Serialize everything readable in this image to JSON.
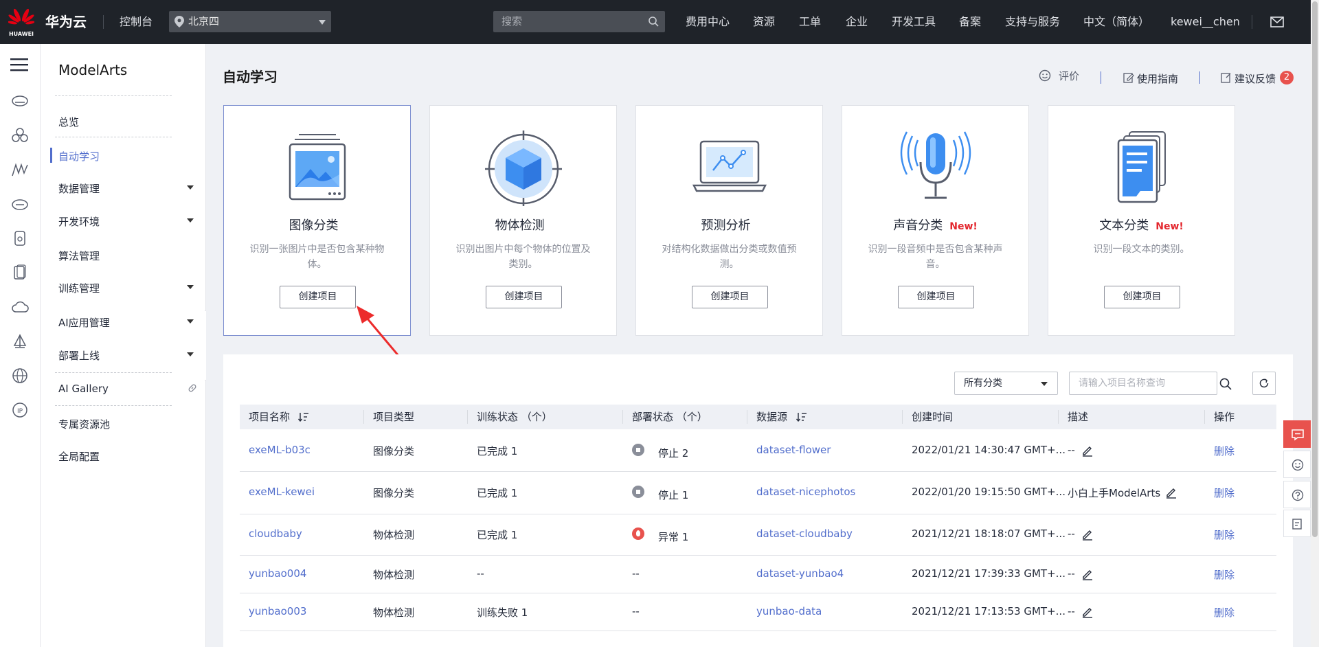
{
  "header": {
    "brand_logo_text": "HUAWEI",
    "brand_name": "华为云",
    "console_label": "控制台",
    "region": "北京四",
    "search_placeholder": "搜索",
    "menu": [
      "费用中心",
      "资源",
      "工单",
      "企业",
      "开发工具",
      "备案",
      "支持与服务",
      "中文（简体）",
      "kewei__chen"
    ]
  },
  "sidebar": {
    "title": "ModelArts",
    "items": [
      {
        "label": "总览"
      },
      {
        "label": "自动学习",
        "active": true
      },
      {
        "label": "数据管理"
      },
      {
        "label": "开发环境"
      },
      {
        "label": "算法管理"
      },
      {
        "label": "训练管理"
      },
      {
        "label": "AI应用管理"
      },
      {
        "label": "部署上线"
      },
      {
        "label": "AI Gallery"
      },
      {
        "label": "专属资源池"
      },
      {
        "label": "全局配置"
      }
    ]
  },
  "page": {
    "title": "自动学习",
    "actions": {
      "rate": "评价",
      "guide": "使用指南",
      "feedback": "建议反馈",
      "feedback_count": "2"
    }
  },
  "cards": [
    {
      "title": "图像分类",
      "new": "",
      "desc": "识别一张图片中是否包含某种物体。",
      "button": "创建项目",
      "icon": "image-classification-icon"
    },
    {
      "title": "物体检测",
      "new": "",
      "desc": "识别出图片中每个物体的位置及类别。",
      "button": "创建项目",
      "icon": "object-detection-icon"
    },
    {
      "title": "预测分析",
      "new": "",
      "desc": "对结构化数据做出分类或数值预测。",
      "button": "创建项目",
      "icon": "predictive-analysis-icon"
    },
    {
      "title": "声音分类",
      "new": "New!",
      "desc": "识别一段音频中是否包含某种声音。",
      "button": "创建项目",
      "icon": "sound-classification-icon"
    },
    {
      "title": "文本分类",
      "new": "New!",
      "desc": "识别一段文本的类别。",
      "button": "创建项目",
      "icon": "text-classification-icon"
    }
  ],
  "filters": {
    "category": "所有分类",
    "search_placeholder": "请输入项目名称查询"
  },
  "table": {
    "headers": [
      "项目名称",
      "项目类型",
      "训练状态 （个）",
      "部署状态 （个）",
      "数据源",
      "创建时间",
      "描述",
      "操作"
    ],
    "rows": [
      {
        "name": "exeML-b03c",
        "type": "图像分类",
        "train": "已完成 1",
        "deploy": "停止 2",
        "deploy_state": "stopped",
        "source": "dataset-flower",
        "time": "2022/01/21 14:30:47 GMT+...",
        "desc": "--",
        "op": "删除"
      },
      {
        "name": "exeML-kewei",
        "type": "图像分类",
        "train": "已完成 1",
        "deploy": "停止 1",
        "deploy_state": "stopped",
        "source": "dataset-nicephotos",
        "time": "2022/01/20 19:15:50 GMT+...",
        "desc": "小白上手ModelArts",
        "op": "删除"
      },
      {
        "name": "cloudbaby",
        "type": "物体检测",
        "train": "已完成 1",
        "deploy": "异常 1",
        "deploy_state": "error",
        "source": "dataset-cloudbaby",
        "time": "2021/12/21 18:18:07 GMT+...",
        "desc": "--",
        "op": "删除"
      },
      {
        "name": "yunbao004",
        "type": "物体检测",
        "train": "--",
        "deploy": "--",
        "deploy_state": "none",
        "source": "dataset-yunbao4",
        "time": "2021/12/21 17:39:33 GMT+...",
        "desc": "--",
        "op": "删除"
      },
      {
        "name": "yunbao003",
        "type": "物体检测",
        "train": "训练失败 1",
        "deploy": "--",
        "deploy_state": "none",
        "source": "yunbao-data",
        "time": "2021/12/21 17:13:53 GMT+...",
        "desc": "--",
        "op": "删除"
      }
    ]
  },
  "colors": {
    "topbar": "#1f2329",
    "accent": "#526ecc",
    "new_badge": "#e3262d",
    "float_active": "#e8524d"
  }
}
